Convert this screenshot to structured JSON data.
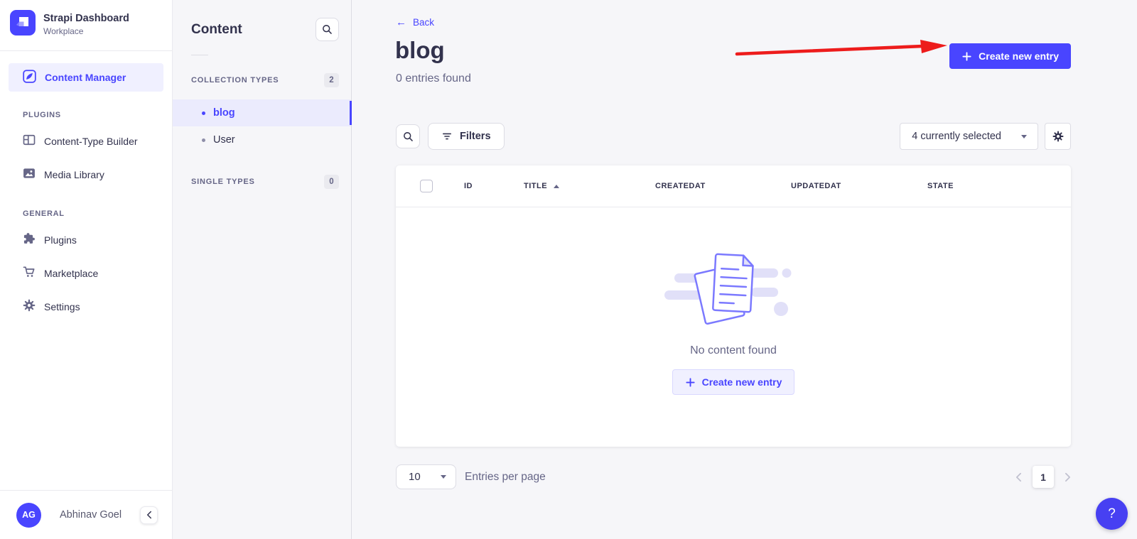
{
  "sidebar": {
    "brand_title": "Strapi Dashboard",
    "brand_subtitle": "Workplace",
    "content_manager_label": "Content Manager",
    "plugins_section_label": "PLUGINS",
    "content_type_builder_label": "Content-Type Builder",
    "media_library_label": "Media Library",
    "general_section_label": "GENERAL",
    "plugins_label": "Plugins",
    "marketplace_label": "Marketplace",
    "settings_label": "Settings",
    "user_initials": "AG",
    "user_name": "Abhinav Goel"
  },
  "subnav": {
    "title": "Content",
    "collection_types_label": "COLLECTION TYPES",
    "collection_types_count": "2",
    "collection_items": [
      {
        "label": "blog",
        "active": true
      },
      {
        "label": "User",
        "active": false
      }
    ],
    "single_types_label": "SINGLE TYPES",
    "single_types_count": "0"
  },
  "header": {
    "back_label": "Back",
    "title": "blog",
    "subtitle": "0 entries found",
    "create_button_label": "Create new entry"
  },
  "toolbar": {
    "filters_label": "Filters",
    "selected_dropdown_value": "4 currently selected"
  },
  "table": {
    "columns": [
      "ID",
      "TITLE",
      "CREATEDAT",
      "UPDATEDAT",
      "STATE"
    ],
    "sorted_column": "TITLE",
    "sort_direction": "asc"
  },
  "empty_state": {
    "message": "No content found",
    "create_button_label": "Create new entry"
  },
  "pagination": {
    "page_size": "10",
    "entries_per_page_label": "Entries per page",
    "current_page": "1"
  },
  "help_button_label": "?",
  "colors": {
    "primary": "#4945ff",
    "active_background": "#f0f0ff",
    "annotation_arrow": "#ed1c1c",
    "surface": "#ffffff",
    "page_background": "#f6f6f9"
  }
}
